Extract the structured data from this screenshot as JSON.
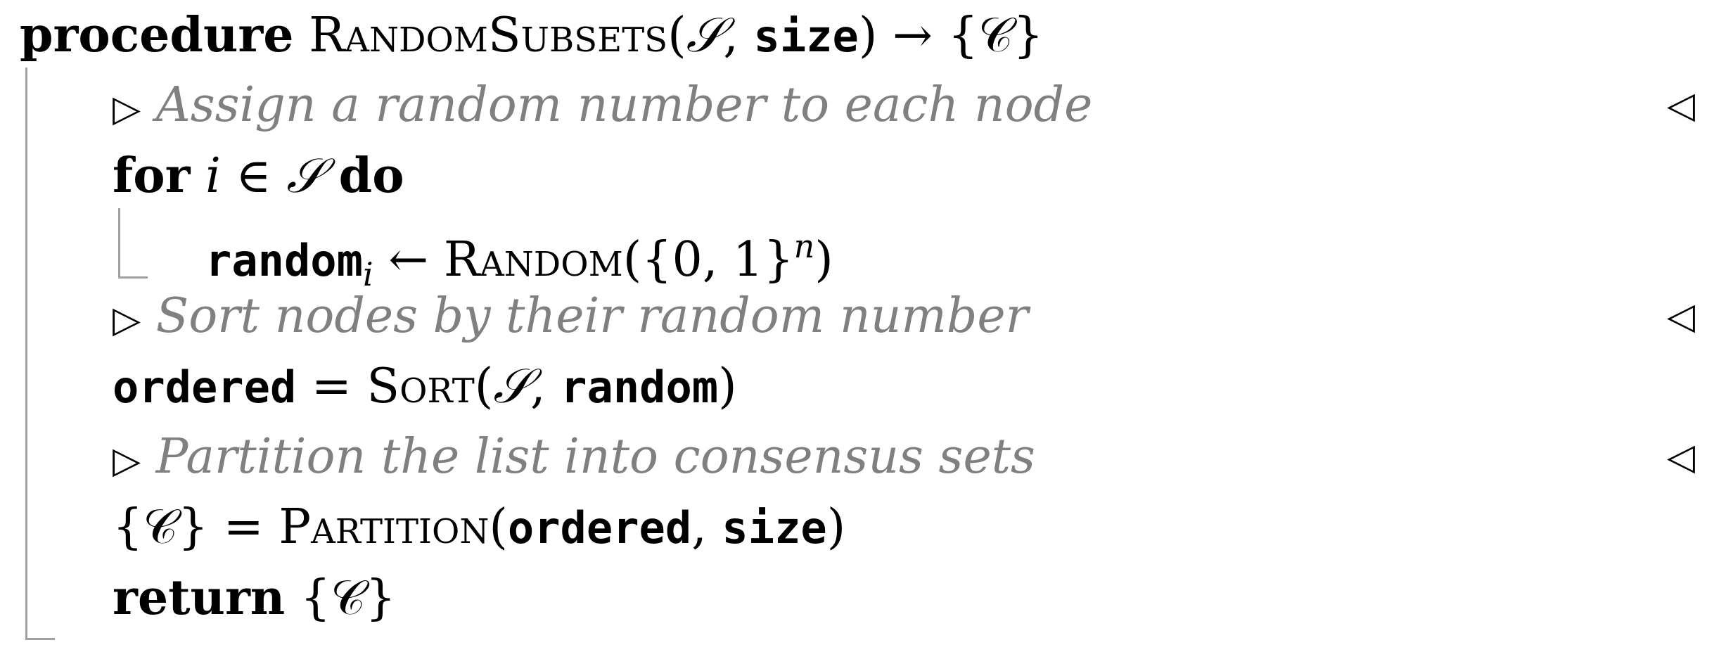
{
  "header": {
    "keyword": "procedure",
    "name": "RandomSubsets",
    "open": "(",
    "arg1": "𝒮",
    "comma": ", ",
    "arg2": "size",
    "close": ")",
    "arrow": " → ",
    "ret": "{𝒞}"
  },
  "comments": {
    "c1": "Assign a random number to each node",
    "c2": "Sort nodes by their random number",
    "c3": "Partition the list into consensus sets",
    "left_marker": "▷",
    "right_marker": "◁"
  },
  "for_line": {
    "kw_for": "for",
    "var": "i",
    "in": " ∈ ",
    "set": "𝒮",
    "kw_do": "do"
  },
  "assign_random": {
    "lhs": "random",
    "sub": "i",
    "arrow": " ← ",
    "func": "Random",
    "arg": "({0, 1}",
    "sup": "n",
    "close": ")"
  },
  "sort_line": {
    "lhs": "ordered",
    "eq": " = ",
    "func": "Sort",
    "open": "(",
    "arg1": "𝒮",
    "comma": ", ",
    "arg2": "random",
    "close": ")"
  },
  "partition_line": {
    "lhs": "{𝒞}",
    "eq": " = ",
    "func": "Partition",
    "open": "(",
    "arg1": "ordered",
    "comma": ", ",
    "arg2": "size",
    "close": ")"
  },
  "return_line": {
    "kw": "return",
    "val": " {𝒞}"
  }
}
